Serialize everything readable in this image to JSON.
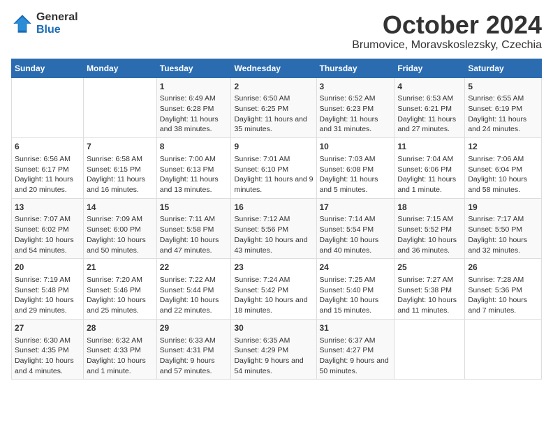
{
  "logo": {
    "general": "General",
    "blue": "Blue"
  },
  "title": "October 2024",
  "subtitle": "Brumovice, Moravskoslezsky, Czechia",
  "days_of_week": [
    "Sunday",
    "Monday",
    "Tuesday",
    "Wednesday",
    "Thursday",
    "Friday",
    "Saturday"
  ],
  "weeks": [
    [
      {
        "day": "",
        "info": ""
      },
      {
        "day": "",
        "info": ""
      },
      {
        "day": "1",
        "info": "Sunrise: 6:49 AM\nSunset: 6:28 PM\nDaylight: 11 hours\nand 38 minutes."
      },
      {
        "day": "2",
        "info": "Sunrise: 6:50 AM\nSunset: 6:25 PM\nDaylight: 11 hours\nand 35 minutes."
      },
      {
        "day": "3",
        "info": "Sunrise: 6:52 AM\nSunset: 6:23 PM\nDaylight: 11 hours\nand 31 minutes."
      },
      {
        "day": "4",
        "info": "Sunrise: 6:53 AM\nSunset: 6:21 PM\nDaylight: 11 hours\nand 27 minutes."
      },
      {
        "day": "5",
        "info": "Sunrise: 6:55 AM\nSunset: 6:19 PM\nDaylight: 11 hours\nand 24 minutes."
      }
    ],
    [
      {
        "day": "6",
        "info": "Sunrise: 6:56 AM\nSunset: 6:17 PM\nDaylight: 11 hours\nand 20 minutes."
      },
      {
        "day": "7",
        "info": "Sunrise: 6:58 AM\nSunset: 6:15 PM\nDaylight: 11 hours\nand 16 minutes."
      },
      {
        "day": "8",
        "info": "Sunrise: 7:00 AM\nSunset: 6:13 PM\nDaylight: 11 hours\nand 13 minutes."
      },
      {
        "day": "9",
        "info": "Sunrise: 7:01 AM\nSunset: 6:10 PM\nDaylight: 11 hours\nand 9 minutes."
      },
      {
        "day": "10",
        "info": "Sunrise: 7:03 AM\nSunset: 6:08 PM\nDaylight: 11 hours\nand 5 minutes."
      },
      {
        "day": "11",
        "info": "Sunrise: 7:04 AM\nSunset: 6:06 PM\nDaylight: 11 hours\nand 1 minute."
      },
      {
        "day": "12",
        "info": "Sunrise: 7:06 AM\nSunset: 6:04 PM\nDaylight: 10 hours\nand 58 minutes."
      }
    ],
    [
      {
        "day": "13",
        "info": "Sunrise: 7:07 AM\nSunset: 6:02 PM\nDaylight: 10 hours\nand 54 minutes."
      },
      {
        "day": "14",
        "info": "Sunrise: 7:09 AM\nSunset: 6:00 PM\nDaylight: 10 hours\nand 50 minutes."
      },
      {
        "day": "15",
        "info": "Sunrise: 7:11 AM\nSunset: 5:58 PM\nDaylight: 10 hours\nand 47 minutes."
      },
      {
        "day": "16",
        "info": "Sunrise: 7:12 AM\nSunset: 5:56 PM\nDaylight: 10 hours\nand 43 minutes."
      },
      {
        "day": "17",
        "info": "Sunrise: 7:14 AM\nSunset: 5:54 PM\nDaylight: 10 hours\nand 40 minutes."
      },
      {
        "day": "18",
        "info": "Sunrise: 7:15 AM\nSunset: 5:52 PM\nDaylight: 10 hours\nand 36 minutes."
      },
      {
        "day": "19",
        "info": "Sunrise: 7:17 AM\nSunset: 5:50 PM\nDaylight: 10 hours\nand 32 minutes."
      }
    ],
    [
      {
        "day": "20",
        "info": "Sunrise: 7:19 AM\nSunset: 5:48 PM\nDaylight: 10 hours\nand 29 minutes."
      },
      {
        "day": "21",
        "info": "Sunrise: 7:20 AM\nSunset: 5:46 PM\nDaylight: 10 hours\nand 25 minutes."
      },
      {
        "day": "22",
        "info": "Sunrise: 7:22 AM\nSunset: 5:44 PM\nDaylight: 10 hours\nand 22 minutes."
      },
      {
        "day": "23",
        "info": "Sunrise: 7:24 AM\nSunset: 5:42 PM\nDaylight: 10 hours\nand 18 minutes."
      },
      {
        "day": "24",
        "info": "Sunrise: 7:25 AM\nSunset: 5:40 PM\nDaylight: 10 hours\nand 15 minutes."
      },
      {
        "day": "25",
        "info": "Sunrise: 7:27 AM\nSunset: 5:38 PM\nDaylight: 10 hours\nand 11 minutes."
      },
      {
        "day": "26",
        "info": "Sunrise: 7:28 AM\nSunset: 5:36 PM\nDaylight: 10 hours\nand 7 minutes."
      }
    ],
    [
      {
        "day": "27",
        "info": "Sunrise: 6:30 AM\nSunset: 4:35 PM\nDaylight: 10 hours\nand 4 minutes."
      },
      {
        "day": "28",
        "info": "Sunrise: 6:32 AM\nSunset: 4:33 PM\nDaylight: 10 hours\nand 1 minute."
      },
      {
        "day": "29",
        "info": "Sunrise: 6:33 AM\nSunset: 4:31 PM\nDaylight: 9 hours\nand 57 minutes."
      },
      {
        "day": "30",
        "info": "Sunrise: 6:35 AM\nSunset: 4:29 PM\nDaylight: 9 hours\nand 54 minutes."
      },
      {
        "day": "31",
        "info": "Sunrise: 6:37 AM\nSunset: 4:27 PM\nDaylight: 9 hours\nand 50 minutes."
      },
      {
        "day": "",
        "info": ""
      },
      {
        "day": "",
        "info": ""
      }
    ]
  ]
}
